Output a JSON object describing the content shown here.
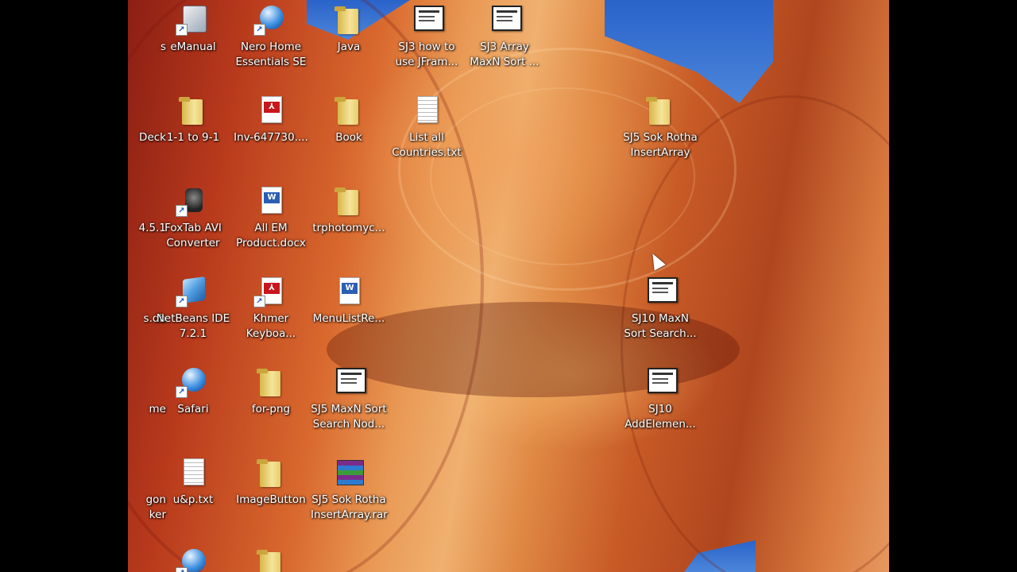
{
  "desktop": {
    "icons": [
      {
        "id": "s-partial",
        "label": "s",
        "col": -1,
        "row": 0,
        "kind": "partial"
      },
      {
        "id": "emanual",
        "label": "eManual",
        "col": 0,
        "row": 0,
        "kind": "manual",
        "shortcut": true
      },
      {
        "id": "nero",
        "label": "Nero Home\nEssentials SE",
        "col": 1,
        "row": 0,
        "kind": "orb",
        "shortcut": true
      },
      {
        "id": "java",
        "label": "Java",
        "col": 2,
        "row": 0,
        "kind": "folder"
      },
      {
        "id": "sj3-jframe",
        "label": "SJ3 how to\nuse JFram...",
        "col": 3,
        "row": 0,
        "kind": "app"
      },
      {
        "id": "sj3-array",
        "label": "SJ3 Array\nMaxN Sort ...",
        "col": 4,
        "row": 0,
        "kind": "app"
      },
      {
        "id": "deck-partial",
        "label": "Deck",
        "col": -1,
        "row": 1,
        "kind": "partial"
      },
      {
        "id": "1-1-to-9-1",
        "label": "1-1 to 9-1",
        "col": 0,
        "row": 1,
        "kind": "folder"
      },
      {
        "id": "inv",
        "label": "Inv-647730....",
        "col": 1,
        "row": 1,
        "kind": "pdf"
      },
      {
        "id": "book",
        "label": "Book",
        "col": 2,
        "row": 1,
        "kind": "folder"
      },
      {
        "id": "list-countries",
        "label": "List all\nCountries.txt",
        "col": 3,
        "row": 1,
        "kind": "txt"
      },
      {
        "id": "sj5-sok-insert",
        "label": "SJ5 Sok Rotha\nInsertArray",
        "col": 6,
        "row": 1,
        "kind": "folder"
      },
      {
        "id": "451-partial",
        "label": "4.5.1",
        "col": -1,
        "row": 2,
        "kind": "partial"
      },
      {
        "id": "foxtab",
        "label": "FoxTab AVI\nConverter",
        "col": 0,
        "row": 2,
        "kind": "speaker",
        "shortcut": true
      },
      {
        "id": "all-em",
        "label": "All EM\nProduct.docx",
        "col": 1,
        "row": 2,
        "kind": "word"
      },
      {
        "id": "trphoto",
        "label": "trphotomyc...",
        "col": 2,
        "row": 2,
        "kind": "folder"
      },
      {
        "id": "db-partial",
        "label": "s.db",
        "col": -1,
        "row": 3,
        "kind": "partial"
      },
      {
        "id": "netbeans",
        "label": "NetBeans IDE\n7.2.1",
        "col": 0,
        "row": 3,
        "kind": "cube",
        "shortcut": true
      },
      {
        "id": "khmer",
        "label": "Khmer\nKeyboa...",
        "col": 1,
        "row": 3,
        "kind": "pdf",
        "shortcut": true
      },
      {
        "id": "menulist",
        "label": "MenuListRe...",
        "col": 2,
        "row": 3,
        "kind": "word"
      },
      {
        "id": "sj10-maxn",
        "label": "SJ10 MaxN\nSort Search...",
        "col": 6,
        "row": 3,
        "kind": "app"
      },
      {
        "id": "me-partial",
        "label": "me",
        "col": -1,
        "row": 4,
        "kind": "partial"
      },
      {
        "id": "safari",
        "label": "Safari",
        "col": 0,
        "row": 4,
        "kind": "orb",
        "shortcut": true
      },
      {
        "id": "for-png",
        "label": "for-png",
        "col": 1,
        "row": 4,
        "kind": "folder"
      },
      {
        "id": "sj5-maxn",
        "label": "SJ5 MaxN Sort\nSearch Nod...",
        "col": 2,
        "row": 4,
        "kind": "app"
      },
      {
        "id": "sj10-add",
        "label": "SJ10\nAddElemen...",
        "col": 6,
        "row": 4,
        "kind": "app"
      },
      {
        "id": "gon-partial",
        "label": "gon\nker",
        "col": -1,
        "row": 5,
        "kind": "partial"
      },
      {
        "id": "uandp",
        "label": "u&p.txt",
        "col": 0,
        "row": 5,
        "kind": "txt"
      },
      {
        "id": "imagebutton",
        "label": "ImageButton",
        "col": 1,
        "row": 5,
        "kind": "folder"
      },
      {
        "id": "sj5-rar",
        "label": "SJ5 Sok Rotha\nInsertArray.rar",
        "col": 2,
        "row": 5,
        "kind": "rar"
      },
      {
        "id": "row6-orb",
        "label": "",
        "col": 0,
        "row": 6,
        "kind": "orb",
        "shortcut": true
      },
      {
        "id": "row6-folder",
        "label": "",
        "col": 1,
        "row": 6,
        "kind": "folder"
      }
    ]
  }
}
